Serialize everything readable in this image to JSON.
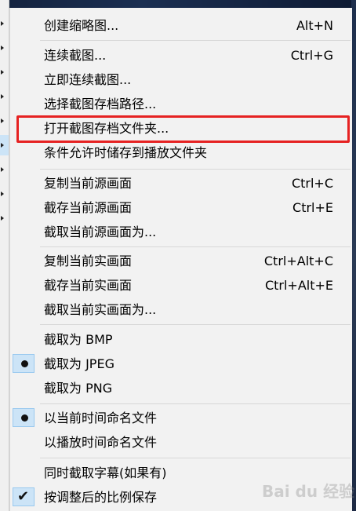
{
  "menu": {
    "groups": [
      {
        "items": [
          {
            "label": "创建缩略图...",
            "shortcut": "Alt+N"
          }
        ]
      },
      {
        "items": [
          {
            "label": "连续截图...",
            "shortcut": "Ctrl+G"
          },
          {
            "label": "立即连续截图...",
            "shortcut": ""
          },
          {
            "label": "选择截图存档路径...",
            "shortcut": ""
          },
          {
            "label": "打开截图存档文件夹...",
            "shortcut": ""
          },
          {
            "label": "条件允许时储存到播放文件夹",
            "shortcut": ""
          }
        ]
      },
      {
        "items": [
          {
            "label": "复制当前源画面",
            "shortcut": "Ctrl+C"
          },
          {
            "label": "截存当前源画面",
            "shortcut": "Ctrl+E"
          },
          {
            "label": "截取当前源画面为...",
            "shortcut": ""
          }
        ]
      },
      {
        "items": [
          {
            "label": "复制当前实画面",
            "shortcut": "Ctrl+Alt+C"
          },
          {
            "label": "截存当前实画面",
            "shortcut": "Ctrl+Alt+E"
          },
          {
            "label": "截取当前实画面为...",
            "shortcut": ""
          }
        ]
      },
      {
        "items": [
          {
            "label": "截取为 BMP",
            "state": "none"
          },
          {
            "label": "截取为 JPEG",
            "state": "radio-selected"
          },
          {
            "label": "截取为 PNG",
            "state": "none"
          }
        ]
      },
      {
        "items": [
          {
            "label": "以当前时间命名文件",
            "state": "radio-selected"
          },
          {
            "label": "以播放时间命名文件",
            "state": "none"
          }
        ]
      },
      {
        "items": [
          {
            "label": "同时截取字幕(如果有)",
            "state": "none"
          },
          {
            "label": "按调整后的比例保存",
            "state": "checked"
          }
        ]
      }
    ]
  },
  "annotation": {
    "highlighted_item": "打开截图存档文件夹...",
    "color": "#e62222"
  },
  "watermark": {
    "text": "Bai du 经验"
  },
  "colors": {
    "menu_bg": "#f2f2f2",
    "selection_bg": "#cce4f7",
    "separator": "#d7d7d7"
  }
}
